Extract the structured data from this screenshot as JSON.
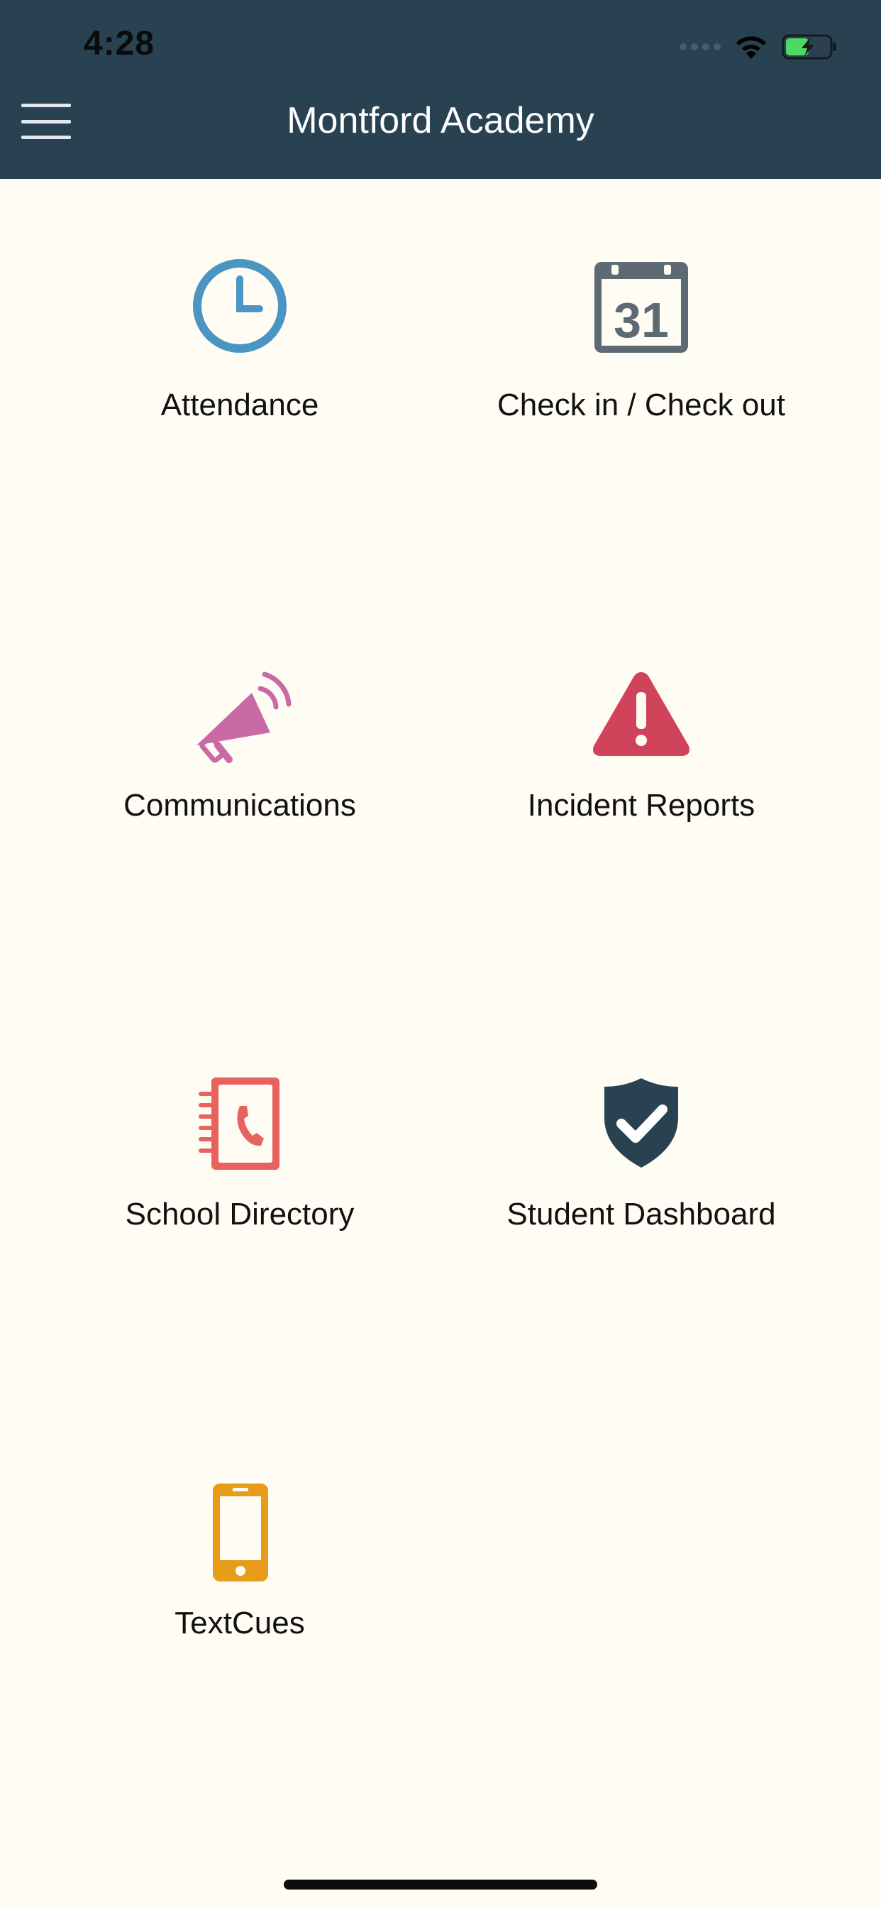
{
  "status_bar": {
    "time": "4:28"
  },
  "nav": {
    "title": "Montford Academy",
    "menu_icon": "hamburger-menu-icon"
  },
  "tiles": [
    {
      "label": "Attendance",
      "icon": "clock-icon",
      "color": "#4a95c2"
    },
    {
      "label": "Check in / Check out",
      "icon": "calendar-icon",
      "color": "#5e6a73",
      "calendar_day": "31"
    },
    {
      "label": "Communications",
      "icon": "megaphone-icon",
      "color": "#c96aa6"
    },
    {
      "label": "Incident Reports",
      "icon": "warning-icon",
      "color": "#d1425b"
    },
    {
      "label": "School Directory",
      "icon": "phone-book-icon",
      "color": "#e8625e"
    },
    {
      "label": "Student Dashboard",
      "icon": "shield-check-icon",
      "color": "#284252"
    },
    {
      "label": "TextCues",
      "icon": "mobile-phone-icon",
      "color": "#e89c1a"
    }
  ],
  "colors": {
    "header": "#284252",
    "background": "#fffcf4"
  }
}
